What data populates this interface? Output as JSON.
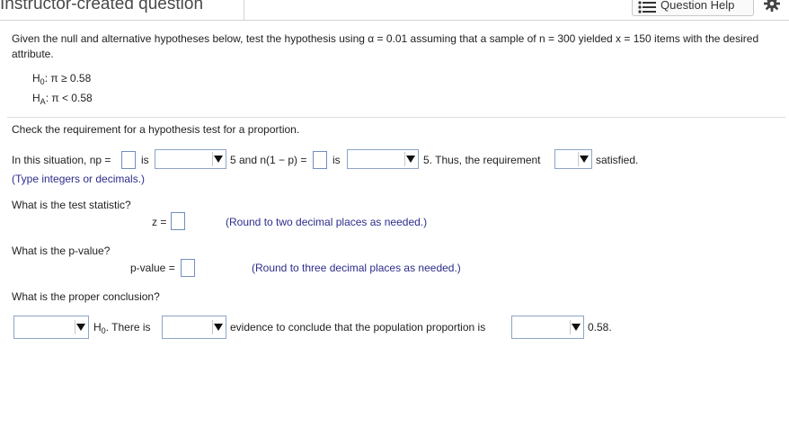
{
  "header": {
    "title": "Instructor-created question",
    "help_label": "Question Help"
  },
  "problem": {
    "text": "Given the null and alternative hypotheses below, test the hypothesis using α = 0.01 assuming that a sample of n = 300 yielded x = 150 items with the desired attribute.",
    "h0_label": "H",
    "h0_sub": "0",
    "h0_expr": ": π ≥ 0.58",
    "ha_label": "H",
    "ha_sub": "A",
    "ha_expr": ": π < 0.58"
  },
  "requirement": {
    "heading": "Check the requirement for a hypothesis test for a proportion.",
    "t1": "In this situation, np =",
    "t2": "is",
    "t3": "5 and n(1 − p) =",
    "t4": "is",
    "t5": "5. Thus, the requirement",
    "t6": "satisfied.",
    "hint": "(Type integers or decimals.)"
  },
  "test_stat": {
    "question": "What is the test statistic?",
    "label": "z =",
    "hint": "(Round to two decimal places as needed.)"
  },
  "p_value": {
    "question": "What is the p-value?",
    "label": "p-value =",
    "hint": "(Round to three decimal places as needed.)"
  },
  "conclusion": {
    "question": "What is the proper conclusion?",
    "h_label": "H",
    "h_sub": "0",
    "t1": ". There is",
    "t2": "evidence to conclude that the population proportion is",
    "t3": "0.58."
  },
  "icons": {
    "help": "list-icon",
    "settings": "gear-icon",
    "dropdown": "triangle-down-icon"
  }
}
